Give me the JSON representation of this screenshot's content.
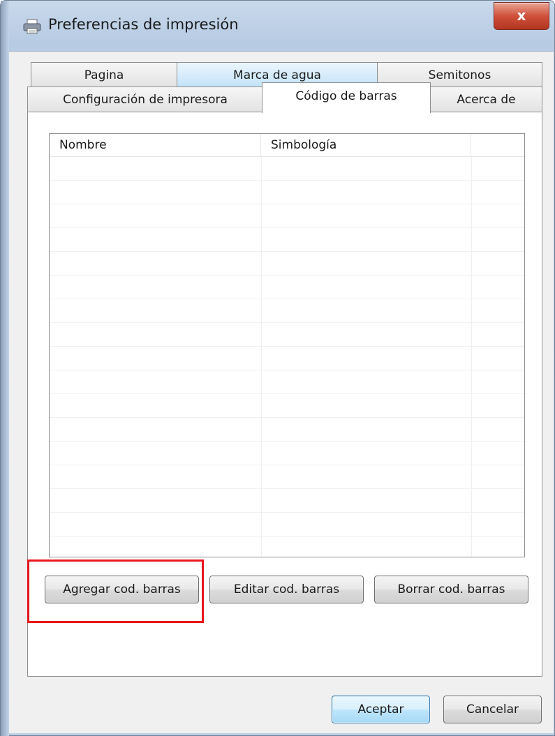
{
  "window": {
    "title": "Preferencias de impresión",
    "close_label": "x"
  },
  "tabs": {
    "row_back": [
      "Pagina",
      "Marca de agua",
      "Semitonos"
    ],
    "row_front": [
      "Configuración de impresora",
      "Código de barras",
      "Acerca de"
    ],
    "selected": "Código de barras",
    "hot": "Marca de agua"
  },
  "barcode_list": {
    "columns": [
      "Nombre",
      "Simbología",
      ""
    ],
    "rows": []
  },
  "barcode_buttons": {
    "add": "Agregar cod. barras",
    "edit": "Editar cod. barras",
    "delete": "Borrar cod. barras"
  },
  "footer": {
    "ok": "Aceptar",
    "cancel": "Cancelar"
  },
  "colors": {
    "highlight": "#e8141c",
    "close_button": "#d0503a",
    "hot_tab": "#bfe1f8"
  },
  "icons": {
    "title": "printer-icon",
    "close": "close-icon"
  }
}
